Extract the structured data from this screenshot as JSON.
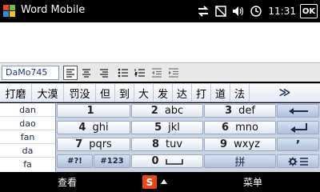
{
  "titlebar": {
    "app_title": "Word Mobile",
    "time": "11:31",
    "ok_label": "OK",
    "icons": [
      "windows-logo-icon",
      "sync-icon",
      "no-signal-icon",
      "volume-icon",
      "clock-icon"
    ]
  },
  "toolbar": {
    "font_name": "DaMo745",
    "buttons": [
      "align-left-icon",
      "align-center-icon",
      "align-right-icon",
      "bullet-list-icon",
      "numbered-list-icon",
      "outdent-icon",
      "indent-icon"
    ]
  },
  "candidates": {
    "items": [
      "打磨",
      "大漠",
      "罚没",
      "但",
      "到",
      "大",
      "发",
      "达",
      "打",
      "道",
      "法"
    ],
    "more_label": "≫"
  },
  "keyboard": {
    "pinyin": [
      "dan",
      "dao",
      "fan",
      "da",
      "fa"
    ],
    "keys": [
      {
        "num": "1",
        "letters": ""
      },
      {
        "num": "2",
        "letters": "abc"
      },
      {
        "num": "3",
        "letters": "def"
      },
      {
        "num": "4",
        "letters": "ghi"
      },
      {
        "num": "5",
        "letters": "jkl"
      },
      {
        "num": "6",
        "letters": "mno"
      },
      {
        "num": "7",
        "letters": "pqrs"
      },
      {
        "num": "8",
        "letters": "tuv"
      },
      {
        "num": "9",
        "letters": "wxyz"
      },
      {
        "num": "0",
        "letters": ""
      }
    ],
    "symbol_key": "#?!",
    "number_key": "#123",
    "pinyin_key": "拼",
    "apostrophe_key": "’"
  },
  "softkeys": {
    "left_label": "查看",
    "ime_label": "S",
    "right_label": "菜单"
  },
  "colors": {
    "ime_brand": "#e24a1a",
    "key_blue": "#1c2c4c"
  }
}
